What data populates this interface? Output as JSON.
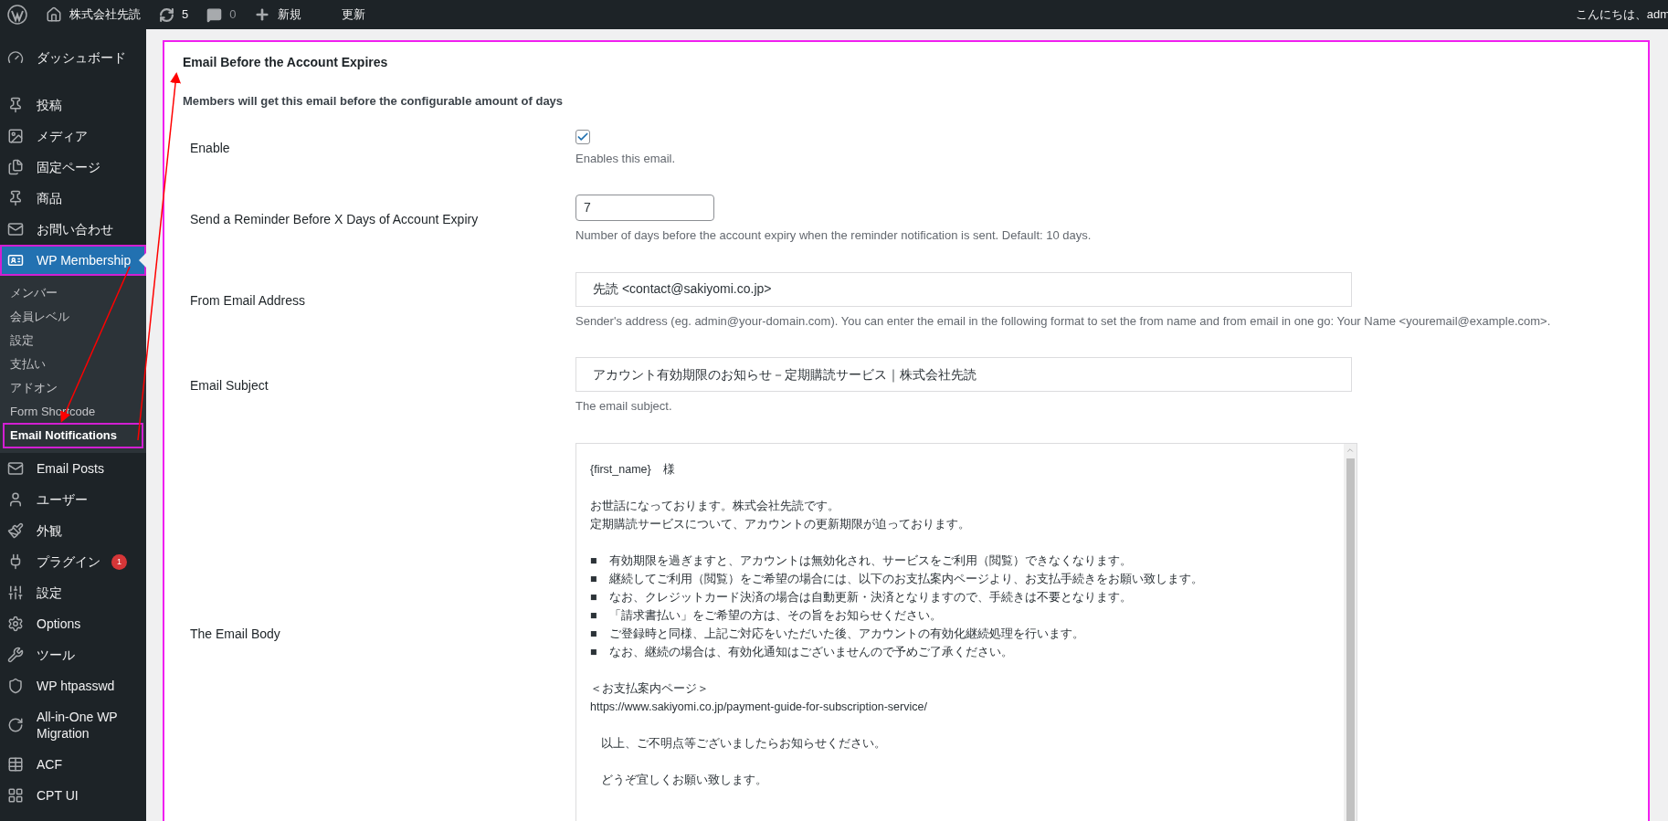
{
  "admin_bar": {
    "site_name": "株式会社先読",
    "updates": "5",
    "comments": "0",
    "new_label": "新規",
    "update_label": "更新",
    "greeting": "こんにちは、adm"
  },
  "sidebar": {
    "items": [
      {
        "label": "ダッシュボード",
        "selected": false,
        "highlighted": false
      },
      {
        "label": "投稿",
        "selected": false,
        "highlighted": false
      },
      {
        "label": "メディア",
        "selected": false,
        "highlighted": false
      },
      {
        "label": "固定ページ",
        "selected": false,
        "highlighted": false
      },
      {
        "label": "商品",
        "selected": false,
        "highlighted": false
      },
      {
        "label": "お問い合わせ",
        "selected": false,
        "highlighted": false
      },
      {
        "label": "WP Membership",
        "selected": true,
        "highlighted": true,
        "children": [
          {
            "label": "メンバー",
            "selected": false,
            "highlighted": false
          },
          {
            "label": "会員レベル",
            "selected": false,
            "highlighted": false
          },
          {
            "label": "設定",
            "selected": false,
            "highlighted": false
          },
          {
            "label": "支払い",
            "selected": false,
            "highlighted": false
          },
          {
            "label": "アドオン",
            "selected": false,
            "highlighted": false
          },
          {
            "label": "Form Shortcode",
            "selected": false,
            "highlighted": false
          },
          {
            "label": "Email Notifications",
            "selected": true,
            "highlighted": true
          }
        ]
      },
      {
        "label": "Email Posts",
        "selected": false,
        "highlighted": false
      },
      {
        "label": "ユーザー",
        "selected": false,
        "highlighted": false
      },
      {
        "label": "外観",
        "selected": false,
        "highlighted": false
      },
      {
        "label": "プラグイン",
        "selected": false,
        "highlighted": false,
        "badge": "1"
      },
      {
        "label": "設定",
        "selected": false,
        "highlighted": false
      },
      {
        "label": "Options",
        "selected": false,
        "highlighted": false
      },
      {
        "label": "ツール",
        "selected": false,
        "highlighted": false
      },
      {
        "label": "WP htpasswd",
        "selected": false,
        "highlighted": false
      },
      {
        "label": "All-in-One WP Migration",
        "selected": false,
        "highlighted": false
      },
      {
        "label": "ACF",
        "selected": false,
        "highlighted": false
      },
      {
        "label": "CPT UI",
        "selected": false,
        "highlighted": false
      }
    ]
  },
  "panel": {
    "title": "Email Before the Account Expires",
    "description": "Members will get this email before the configurable amount of days",
    "highlighted": true,
    "fields": [
      {
        "kind": "checkbox",
        "label": "Enable",
        "checked": true,
        "help": "Enables this email."
      },
      {
        "kind": "number",
        "label": "Send a Reminder Before X Days of Account Expiry",
        "value": "7",
        "help": "Number of days before the account expiry when the reminder notification is sent. Default: 10 days."
      },
      {
        "kind": "text",
        "label": "From Email Address",
        "value": "先読 <contact@sakiyomi.co.jp>",
        "help": "Sender's address (eg. admin@your-domain.com). You can enter the email in the following format to set the from name and from email in one go: Your Name <youremail@example.com>."
      },
      {
        "kind": "text",
        "label": "Email Subject",
        "value": "アカウント有効期限のお知らせ－定期購読サービス｜株式会社先読",
        "help": "The email subject."
      },
      {
        "kind": "textarea",
        "label": "The Email Body",
        "paragraphs": [
          {
            "indented": false,
            "lines": [
              "{first_name}　様"
            ]
          },
          {
            "indented": false,
            "lines": [
              "お世話になっております。株式会社先読です。",
              "定期購読サービスについて、アカウントの更新期限が迫っております。"
            ]
          },
          {
            "indented": false,
            "lines": [
              "■　有効期限を過ぎますと、アカウントは無効化され、サービスをご利用（閲覧）できなくなります。",
              "■　継続してご利用（閲覧）をご希望の場合には、以下のお支払案内ページより、お支払手続きをお願い致します。",
              "■　なお、クレジットカード決済の場合は自動更新・決済となりますので、手続きは不要となります。",
              "■　「請求書払い」をご希望の方は、その旨をお知らせください。",
              "■　ご登録時と同様、上記ご対応をいただいた後、アカウントの有効化継続処理を行います。",
              "■　なお、継続の場合は、有効化通知はございませんので予めご了承ください。"
            ]
          },
          {
            "indented": false,
            "lines": [
              "＜お支払案内ページ＞",
              "https://www.sakiyomi.co.jp/payment-guide-for-subscription-service/"
            ]
          },
          {
            "indented": true,
            "lines": [
              "以上、ご不明点等ございましたらお知らせください。"
            ]
          },
          {
            "indented": true,
            "lines": [
              "どうぞ宜しくお願い致します。"
            ]
          }
        ]
      }
    ]
  }
}
